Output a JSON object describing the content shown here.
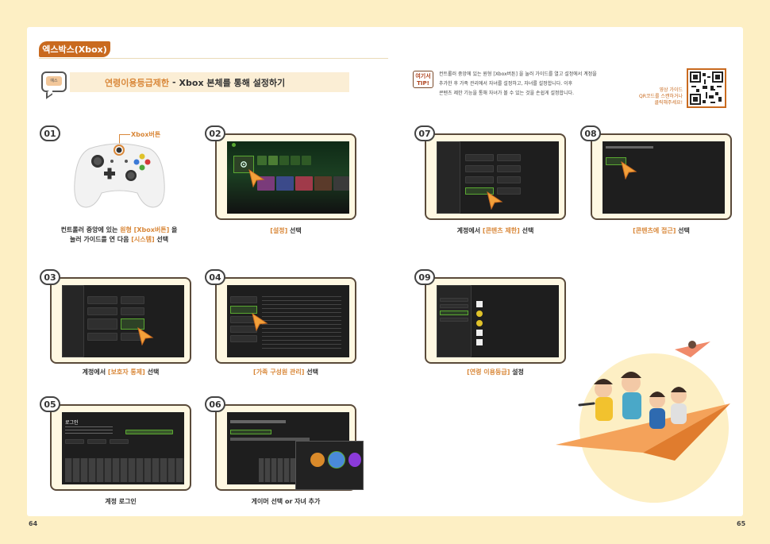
{
  "section": {
    "tag": "엑스박스(Xbox)"
  },
  "title": {
    "speech_icon_text": "예스",
    "highlight": "연령이용등급제한",
    "dash": "-",
    "rest": "Xbox 본체를 통해 설정하기"
  },
  "tip": {
    "icon_line1": "여기서",
    "icon_line2": "TIP!",
    "lines": [
      "컨트롤러 중앙에 있는 원형 [Xbox버튼] 을 눌러 가이드를 열고 설정에서 계정을",
      "추가한 후 가족 관리에서 자녀를 설정하고, 자녀를 설정합니다. 이후",
      "콘텐츠 제한 기능을 통해 자녀가 볼 수 있는 것을 손쉽게 설정합니다."
    ]
  },
  "qr": {
    "caption_lines": [
      "영상 가이드",
      "QR코드를 스캔하거나",
      "클릭해주세요!"
    ]
  },
  "steps": {
    "s01": {
      "num": "01",
      "callout": "Xbox버튼",
      "caption_line1_a": "컨트롤러 중앙에 있는 ",
      "caption_line1_b": "원형 [Xbox버튼]",
      "caption_line1_c": " 을",
      "caption_line2_a": "눌러 가이드를 연 다음 ",
      "caption_line2_b": "[시스템]",
      "caption_line2_c": " 선택"
    },
    "s02": {
      "num": "02",
      "caption_a": "[설정]",
      "caption_b": " 선택"
    },
    "s03": {
      "num": "03",
      "caption_a": "계정에서 ",
      "caption_b": "[보호자 통제]",
      "caption_c": " 선택"
    },
    "s04": {
      "num": "04",
      "caption_a": "[가족 구성원 관리]",
      "caption_b": " 선택"
    },
    "s05": {
      "num": "05",
      "caption": "계정 로그인",
      "screen_title": "로그인"
    },
    "s06": {
      "num": "06",
      "caption": "게이머 선택 or 자녀 추가"
    },
    "s07": {
      "num": "07",
      "caption_a": "계정에서 ",
      "caption_b": "[콘텐츠 제한]",
      "caption_c": " 선택"
    },
    "s08": {
      "num": "08",
      "caption_a": "[콘텐츠에 접근]",
      "caption_b": " 선택"
    },
    "s09": {
      "num": "09",
      "caption_a": "[연령 이용등급]",
      "caption_b": " 설정"
    }
  },
  "pages": {
    "left": "64",
    "right": "65"
  },
  "colors": {
    "accent": "#d9883a",
    "tag": "#c96a1f",
    "xbox_green": "#5aa832",
    "background": "#fdefc4"
  }
}
